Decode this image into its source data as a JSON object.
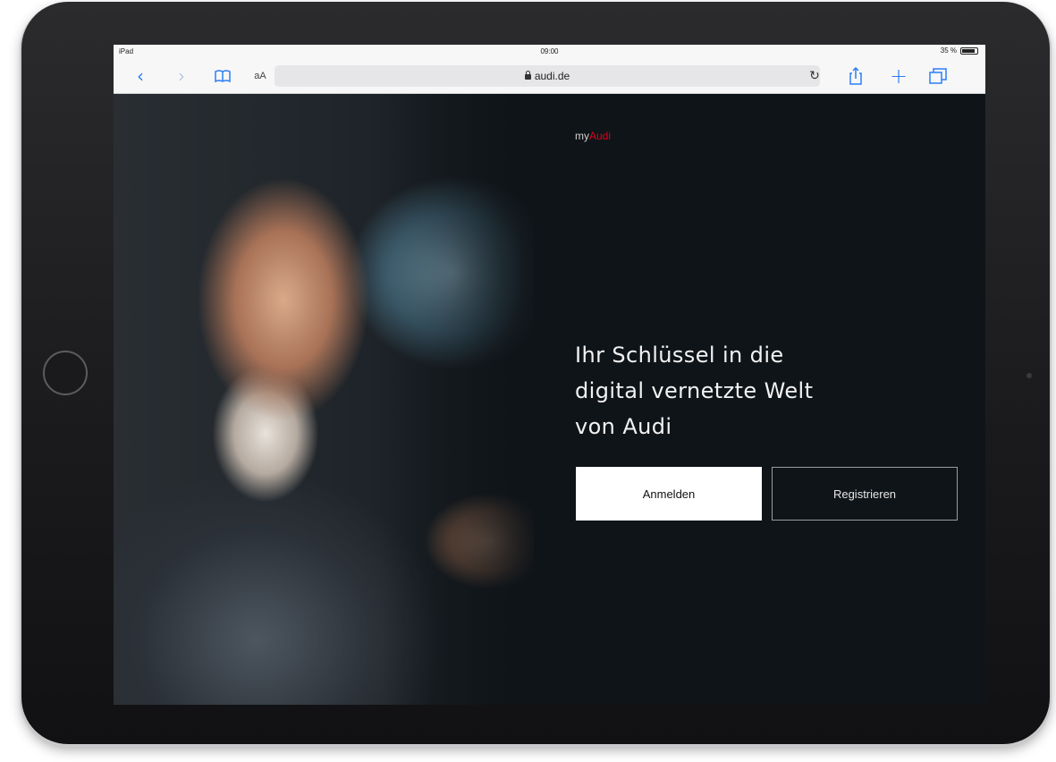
{
  "status_bar": {
    "device": "iPad",
    "time": "09:00",
    "battery": "35 %"
  },
  "browser": {
    "url": "audi.de",
    "aa_label": "aA",
    "icons": {
      "back": "chevron-left-icon",
      "forward": "chevron-right-icon",
      "bookmarks": "book-icon",
      "reload": "reload-icon",
      "share": "share-icon",
      "new_tab": "plus-icon",
      "tabs": "tabs-icon"
    },
    "accent_color": "#2c7ef5"
  },
  "page": {
    "logo": {
      "prefix": "my",
      "brand": "Audi",
      "brand_color": "#e3001b"
    },
    "headline": {
      "line1": "Ihr Schlüssel in die",
      "line2": "digital vernetzte Welt",
      "line3": "von Audi"
    },
    "buttons": {
      "login": "Anmelden",
      "register": "Registrieren"
    },
    "background_color": "#0f1418"
  }
}
